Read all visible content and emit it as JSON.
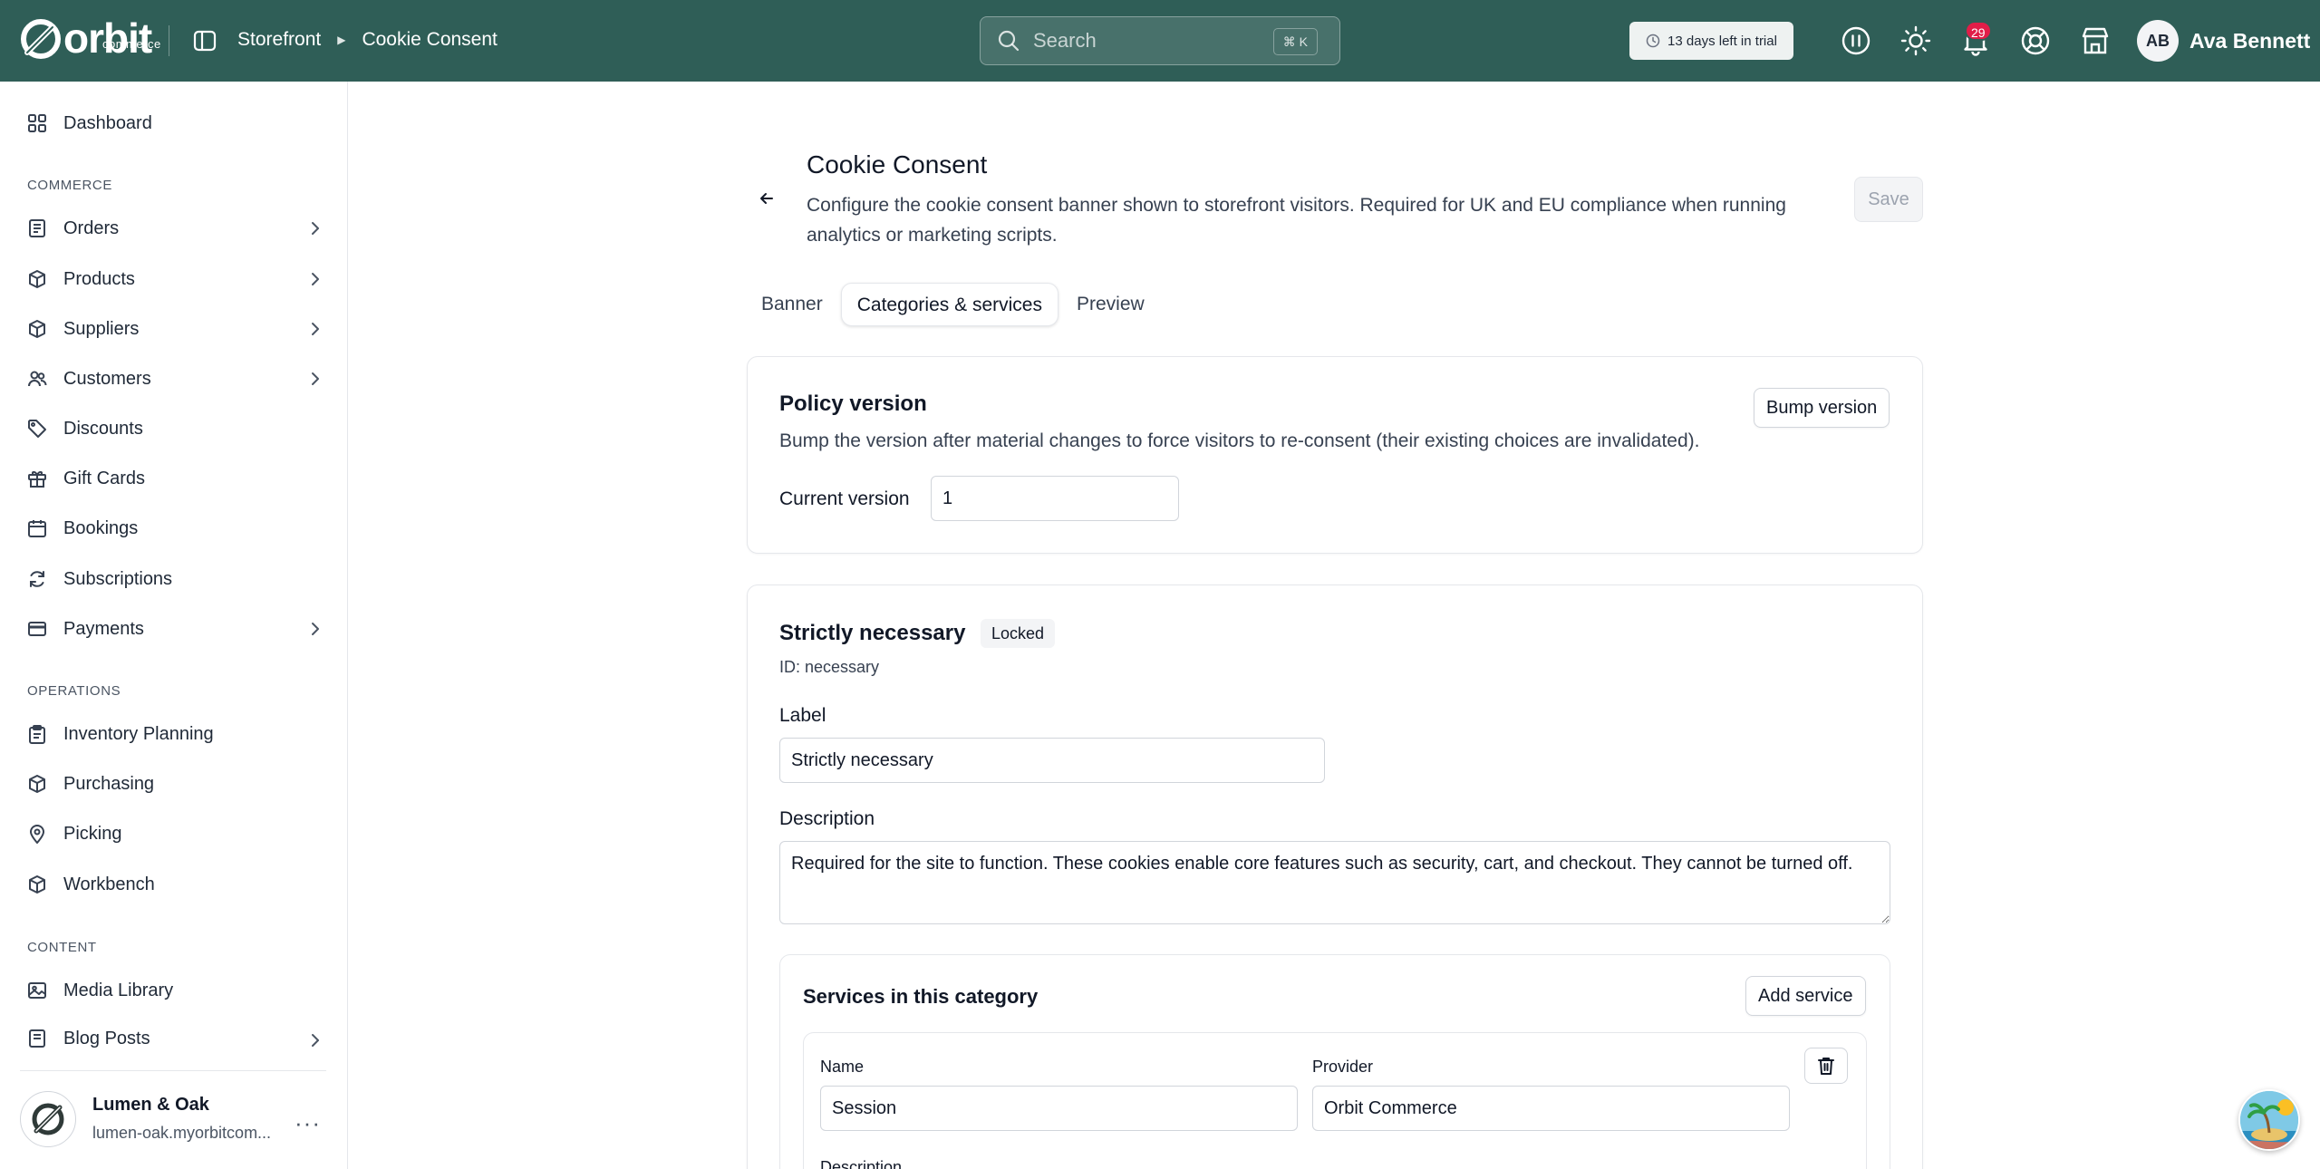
{
  "brand": {
    "name": "orbit",
    "sub": "commerce"
  },
  "breadcrumb": {
    "parent": "Storefront",
    "current": "Cookie Consent"
  },
  "search": {
    "placeholder": "Search",
    "shortcut": "⌘ K"
  },
  "trial": {
    "label": "13 days left in trial"
  },
  "notifications": {
    "count": "29"
  },
  "user": {
    "initials": "AB",
    "name": "Ava Bennett"
  },
  "sidebar": {
    "dashboard": "Dashboard",
    "sections": {
      "commerce": "COMMERCE",
      "operations": "OPERATIONS",
      "content": "CONTENT"
    },
    "commerce_items": [
      "Orders",
      "Products",
      "Suppliers",
      "Customers",
      "Discounts",
      "Gift Cards",
      "Bookings",
      "Subscriptions",
      "Payments"
    ],
    "operations_items": [
      "Inventory Planning",
      "Purchasing",
      "Picking",
      "Workbench"
    ],
    "content_items": [
      "Media Library",
      "Blog Posts"
    ],
    "store": {
      "name": "Lumen & Oak",
      "url": "lumen-oak.myorbitcom..."
    }
  },
  "page": {
    "title": "Cookie Consent",
    "description": "Configure the cookie consent banner shown to storefront visitors. Required for UK and EU compliance when running analytics or marketing scripts.",
    "save_label": "Save",
    "tabs": [
      "Banner",
      "Categories & services",
      "Preview"
    ],
    "active_tab": "Categories & services"
  },
  "policy": {
    "title": "Policy version",
    "description": "Bump the version after material changes to force visitors to re-consent (their existing choices are invalidated).",
    "bump_label": "Bump version",
    "current_label": "Current version",
    "current_value": "1"
  },
  "category": {
    "title": "Strictly necessary",
    "badge": "Locked",
    "id_text": "ID: necessary",
    "label_label": "Label",
    "label_value": "Strictly necessary",
    "description_label": "Description",
    "description_value": "Required for the site to function. These cookies enable core features such as security, cart, and checkout. They cannot be turned off."
  },
  "services": {
    "title": "Services in this category",
    "add_label": "Add service",
    "name_label": "Name",
    "provider_label": "Provider",
    "name_value": "Session",
    "provider_value": "Orbit Commerce",
    "description_label": "Description"
  }
}
